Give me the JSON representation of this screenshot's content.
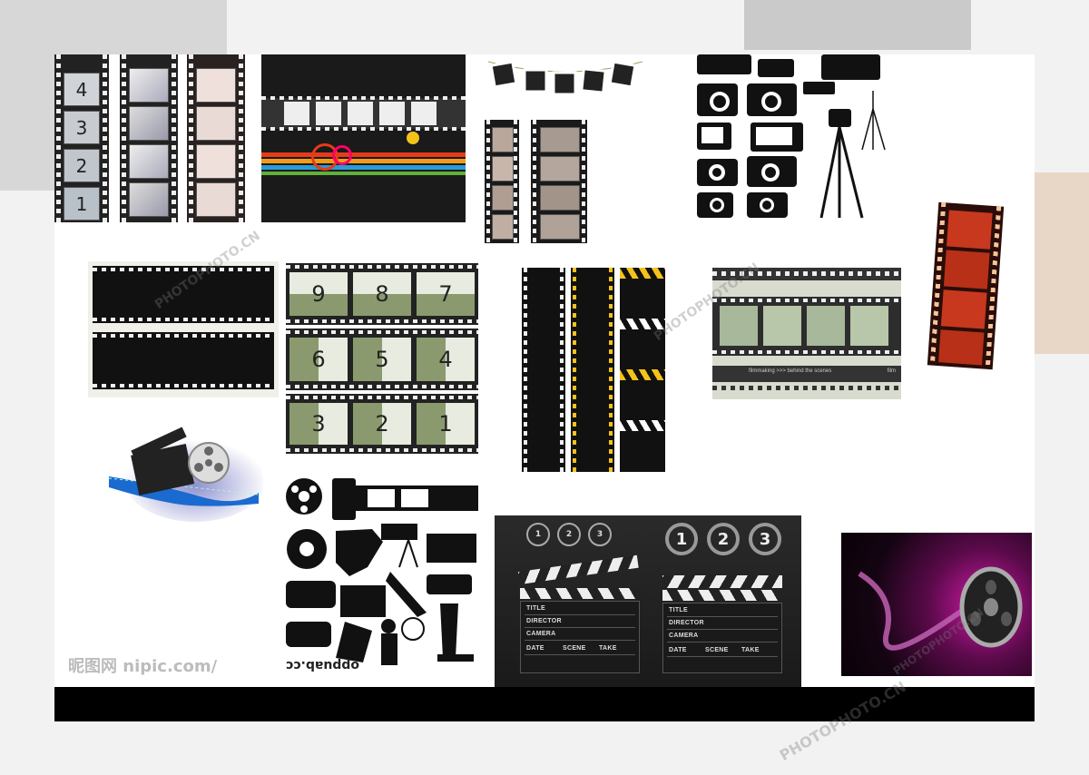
{
  "countdown_strip_numbers": [
    "4",
    "3",
    "2",
    "1"
  ],
  "countdown_grid_numbers": [
    "9",
    "8",
    "7",
    "6",
    "5",
    "4",
    "3",
    "2",
    "1"
  ],
  "clapper_circles": [
    "1",
    "2",
    "3"
  ],
  "clapper_fields": [
    "TITLE",
    "DIRECTOR",
    "CAMERA"
  ],
  "clapper_bottom": [
    "DATE",
    "SCENE",
    "TAKE"
  ],
  "film_caption": "filmmaking >>> behind the scenes",
  "film_tag": "film",
  "source_watermark": "昵图网 nipic.com/",
  "bottom_text": "oppuab.cc",
  "site_watermark": "PHOTOPHOTO.CN",
  "colors": {
    "sheet": "#ffffff",
    "film_black": "#111111",
    "film_red": "#c8381e",
    "countdown_green": "#8a9a6e",
    "magenta_glow": "#d01aa8",
    "footer": "#000000"
  }
}
